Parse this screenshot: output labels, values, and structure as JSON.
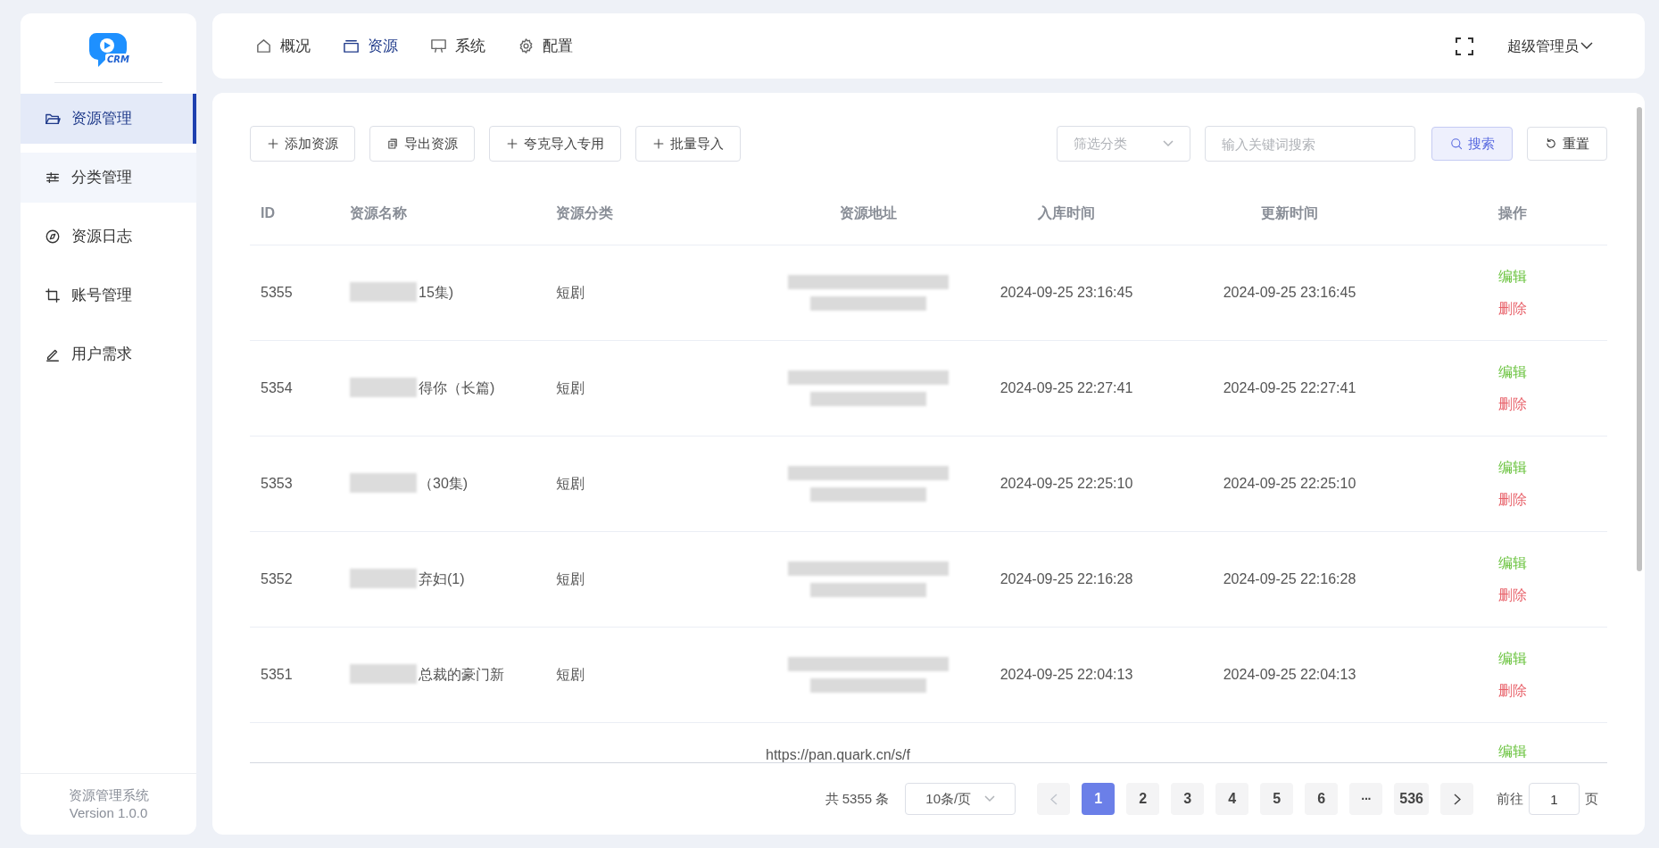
{
  "logo_text": "CRM",
  "sidebar": {
    "items": [
      {
        "label": "资源管理",
        "selected": true,
        "hovered": false
      },
      {
        "label": "分类管理",
        "selected": false,
        "hovered": true
      },
      {
        "label": "资源日志",
        "selected": false,
        "hovered": false
      },
      {
        "label": "账号管理",
        "selected": false,
        "hovered": false
      },
      {
        "label": "用户需求",
        "selected": false,
        "hovered": false
      }
    ],
    "footer": {
      "name": "资源管理系统",
      "version": "Version 1.0.0"
    }
  },
  "topnav": {
    "tabs": [
      {
        "label": "概况",
        "selected": false
      },
      {
        "label": "资源",
        "selected": true
      },
      {
        "label": "系统",
        "selected": false
      },
      {
        "label": "配置",
        "selected": false
      }
    ],
    "user": "超级管理员"
  },
  "toolbar": {
    "buttons": [
      {
        "label": "添加资源"
      },
      {
        "label": "导出资源"
      },
      {
        "label": "夸克导入专用"
      },
      {
        "label": "批量导入"
      }
    ],
    "filter": {
      "placeholder": "筛选分类"
    },
    "search": {
      "placeholder": "输入关键词搜索"
    },
    "search_button": "搜索",
    "reset_button": "重置"
  },
  "table": {
    "columns": [
      "ID",
      "资源名称",
      "资源分类",
      "资源地址",
      "入库时间",
      "更新时间",
      "操作"
    ],
    "rows": [
      {
        "id": "5355",
        "name_blurred": true,
        "name": "15集)",
        "category": "短剧",
        "address_blurred": true,
        "created": "2024-09-25 23:16:45",
        "updated": "2024-09-25 23:16:45",
        "actions": [
          {
            "label": "编辑",
            "kind": "edit"
          },
          {
            "label": "删除",
            "kind": "delete"
          }
        ]
      },
      {
        "id": "5354",
        "name_blurred": true,
        "name": "得你（长篇)",
        "category": "短剧",
        "address_blurred": true,
        "created": "2024-09-25 22:27:41",
        "updated": "2024-09-25 22:27:41",
        "actions": [
          {
            "label": "编辑",
            "kind": "edit"
          },
          {
            "label": "删除",
            "kind": "delete"
          }
        ]
      },
      {
        "id": "5353",
        "name_blurred": true,
        "name": "（30集)",
        "category": "短剧",
        "address_blurred": true,
        "created": "2024-09-25 22:25:10",
        "updated": "2024-09-25 22:25:10",
        "actions": [
          {
            "label": "编辑",
            "kind": "edit"
          },
          {
            "label": "删除",
            "kind": "delete"
          }
        ]
      },
      {
        "id": "5352",
        "name_blurred": true,
        "name": "弃妇(1)",
        "category": "短剧",
        "address_blurred": true,
        "created": "2024-09-25 22:16:28",
        "updated": "2024-09-25 22:16:28",
        "actions": [
          {
            "label": "编辑",
            "kind": "edit"
          },
          {
            "label": "删除",
            "kind": "delete"
          }
        ]
      },
      {
        "id": "5351",
        "name_blurred": true,
        "name": "总裁的豪门新",
        "category": "短剧",
        "address_blurred": true,
        "created": "2024-09-25 22:04:13",
        "updated": "2024-09-25 22:04:13",
        "actions": [
          {
            "label": "编辑",
            "kind": "edit"
          },
          {
            "label": "删除",
            "kind": "delete"
          }
        ]
      },
      {
        "name_blurred": false,
        "address_blurred": false,
        "address": "https://pan.quark.cn/s/f",
        "actions": [
          {
            "label": "编辑",
            "kind": "edit"
          }
        ]
      }
    ]
  },
  "pagination": {
    "total": "共 5355 条",
    "page_size": "10条/页",
    "pages": [
      {
        "label": "1",
        "kind": "page",
        "selected": true
      },
      {
        "label": "2",
        "kind": "page",
        "selected": false
      },
      {
        "label": "3",
        "kind": "page",
        "selected": false
      },
      {
        "label": "4",
        "kind": "page",
        "selected": false
      },
      {
        "label": "5",
        "kind": "page",
        "selected": false
      },
      {
        "label": "6",
        "kind": "page",
        "selected": false
      },
      {
        "label": "···",
        "kind": "more",
        "selected": false
      },
      {
        "label": "536",
        "kind": "page",
        "selected": false
      }
    ],
    "goto_label": "前往",
    "goto_value": "1",
    "goto_suffix": "页"
  }
}
